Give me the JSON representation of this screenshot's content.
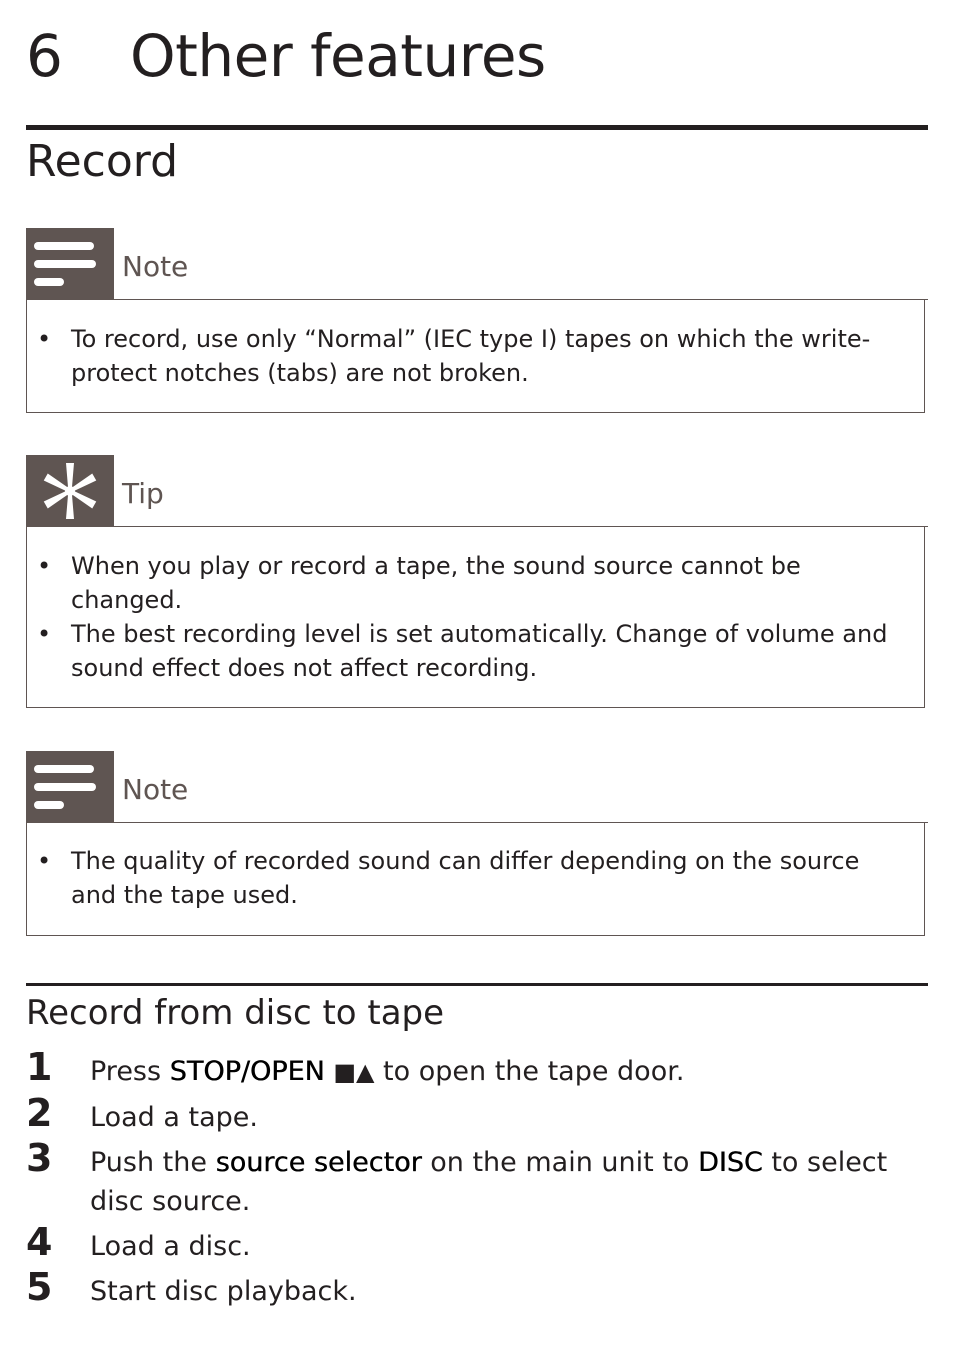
{
  "chapter": {
    "number": "6",
    "title": "Other features"
  },
  "section": {
    "title": "Record"
  },
  "boxes": [
    {
      "type": "note",
      "icon": "note-icon",
      "label": "Note",
      "items": [
        "To record, use only “Normal” (IEC type I) tapes on which the write-protect notches (tabs) are not broken."
      ]
    },
    {
      "type": "tip",
      "icon": "tip-asterisk-icon",
      "label": "Tip",
      "items": [
        "When you play or record a tape, the sound source cannot be changed.",
        "The best recording level is set automatically. Change of volume and sound effect does not affect recording."
      ]
    },
    {
      "type": "note",
      "icon": "note-icon",
      "label": "Note",
      "items": [
        "The quality of recorded sound can differ depending on the source and the tape used."
      ]
    }
  ],
  "subsection": {
    "title": "Record from disc to tape"
  },
  "steps": [
    {
      "n": "1",
      "pre": "Press ",
      "bold": "STOP/OPEN",
      "icons": "■▲",
      "post": " to open the tape door."
    },
    {
      "n": "2",
      "text": "Load a tape."
    },
    {
      "n": "3",
      "pre": "Push the ",
      "bold": "source selector",
      "mid": " on the main unit to ",
      "bold2": "DISC",
      "post": " to select disc source."
    },
    {
      "n": "4",
      "text": "Load a disc."
    },
    {
      "n": "5",
      "text": "Start disc playback."
    }
  ],
  "colors": {
    "icon_bg": "#5f5552",
    "text": "#231f20"
  }
}
